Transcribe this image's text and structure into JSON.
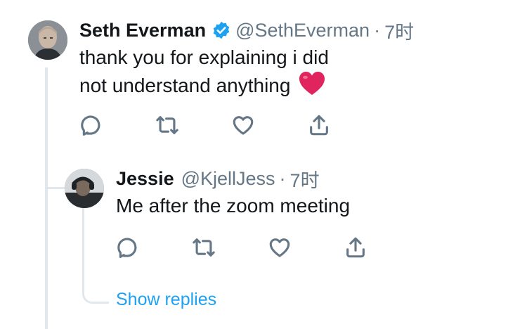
{
  "tweet": {
    "display_name": "Seth Everman",
    "handle": "@SethEverman",
    "separator": "·",
    "time": "7时",
    "text": "thank you for explaining i did not understand anything",
    "emoji": "❤️",
    "verified": true,
    "icons": [
      "reply-icon",
      "retweet-icon",
      "like-icon",
      "share-icon"
    ]
  },
  "reply": {
    "display_name": "Jessie",
    "handle": "@KjellJess",
    "separator": "·",
    "time": "7时",
    "text": "Me after the zoom meeting",
    "icons": [
      "reply-icon",
      "retweet-icon",
      "like-icon",
      "share-icon"
    ]
  },
  "show_replies_label": "Show replies",
  "colors": {
    "accent": "#1da1f2",
    "verified": "#1da1f2",
    "muted": "#657786",
    "thread_line": "#e1e8ed",
    "heart": "#e0245e"
  }
}
